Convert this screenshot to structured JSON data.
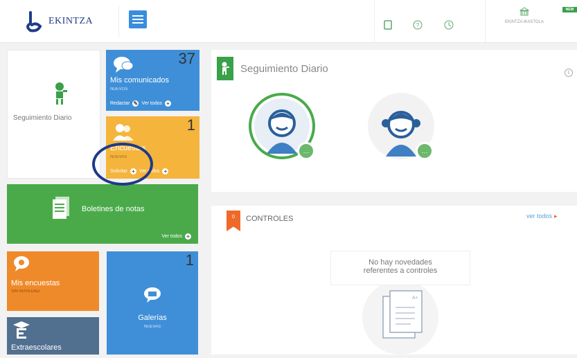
{
  "app": {
    "logo_text": "EKINTZA"
  },
  "topbar": {
    "school_name": "EKINTZA IKASTOLA",
    "badge": "NEW",
    "icons": [
      "tablet-icon",
      "help-icon",
      "history-icon",
      "school-icon"
    ]
  },
  "tiles": {
    "seguimiento": {
      "title": "Seguimiento Diario"
    },
    "comunicados": {
      "title": "Mis comunicados",
      "sub": "NUEVOS",
      "count": "37",
      "action_write": "Redactar",
      "action_all": "Ver todos"
    },
    "encuestas_top": {
      "title": "Encuestas",
      "sub": "NUEVAS",
      "count": "1",
      "action_write": "Solicitar",
      "action_all": "Ver todos"
    },
    "boletines": {
      "title": "Boletines de notas",
      "action_all": "Ver todos"
    },
    "mis_encuestas": {
      "title": "Mis encuestas",
      "sub": "SIN NOVEDAD"
    },
    "galerias": {
      "title": "Galerías",
      "sub": "NUEVAS",
      "count": "1"
    },
    "extraescolares": {
      "title": "Extraescolares"
    }
  },
  "panel": {
    "seguimiento_title": "Seguimiento Diario",
    "controles_title": "CONTROLES",
    "controles_flag": "0",
    "ver_todos": "ver todos",
    "empty_line1": "No hay novedades",
    "empty_line2": "referentes a controles"
  },
  "colors": {
    "blue": "#3f8fd8",
    "yellow": "#f5b43c",
    "green": "#4aaa4a",
    "orange": "#ef8a2a",
    "slate": "#516f8f",
    "annotation": "#1d3a8a"
  }
}
